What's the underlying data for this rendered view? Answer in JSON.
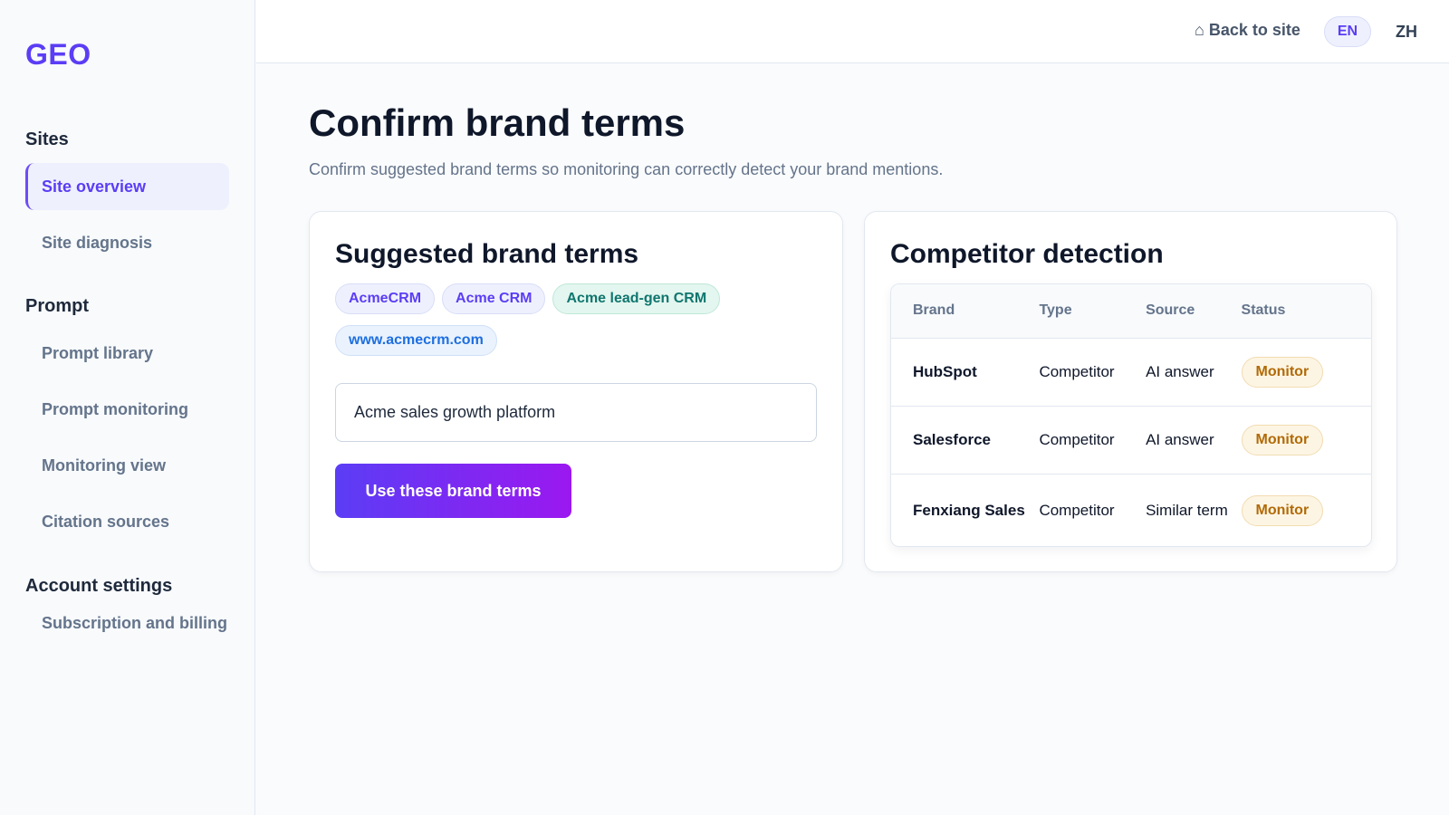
{
  "app": {
    "logo": "GEO"
  },
  "sidebar": {
    "sections": [
      {
        "title": "Sites",
        "items": [
          {
            "label": "Site overview",
            "active": true
          },
          {
            "label": "Site diagnosis"
          }
        ]
      },
      {
        "title": "Prompt",
        "items": [
          {
            "label": "Prompt library"
          },
          {
            "label": "Prompt monitoring"
          },
          {
            "label": "Monitoring view"
          },
          {
            "label": "Citation sources"
          }
        ]
      },
      {
        "title": "Account settings",
        "items": [
          {
            "label": "Subscription and billing"
          }
        ]
      }
    ]
  },
  "topbar": {
    "back_icon": "home-icon",
    "back_glyph": "⌂",
    "back_label": "Back to site",
    "languages": [
      {
        "label": "EN",
        "active": true
      },
      {
        "label": "ZH"
      }
    ]
  },
  "page": {
    "title": "Confirm brand terms",
    "subtitle": "Confirm suggested brand terms so monitoring can correctly detect your brand mentions."
  },
  "suggested": {
    "title": "Suggested brand terms",
    "chips": [
      {
        "label": "AcmeCRM",
        "style": "purple"
      },
      {
        "label": "Acme CRM",
        "style": "purple"
      },
      {
        "label": "Acme lead-gen CRM",
        "style": "green"
      },
      {
        "label": "www.acmecrm.com",
        "style": "blue"
      }
    ],
    "input_value": "Acme sales growth platform",
    "button_label": "Use these brand terms"
  },
  "competitors": {
    "title": "Competitor detection",
    "columns": [
      "Brand",
      "Type",
      "Source",
      "Status"
    ],
    "rows": [
      {
        "brand": "HubSpot",
        "type": "Competitor",
        "source": "AI answer",
        "status": "Monitor"
      },
      {
        "brand": "Salesforce",
        "type": "Competitor",
        "source": "AI answer",
        "status": "Monitor"
      },
      {
        "brand": "Fenxiang Sales",
        "type": "Competitor",
        "source": "Similar term",
        "status": "Monitor"
      }
    ]
  },
  "colors": {
    "accent": "#5b3df5",
    "accent_gradient_end": "#9b18f0",
    "status_monitor": "#b26a06",
    "chip_green": "#0f766e",
    "chip_blue": "#1d6fe0"
  }
}
